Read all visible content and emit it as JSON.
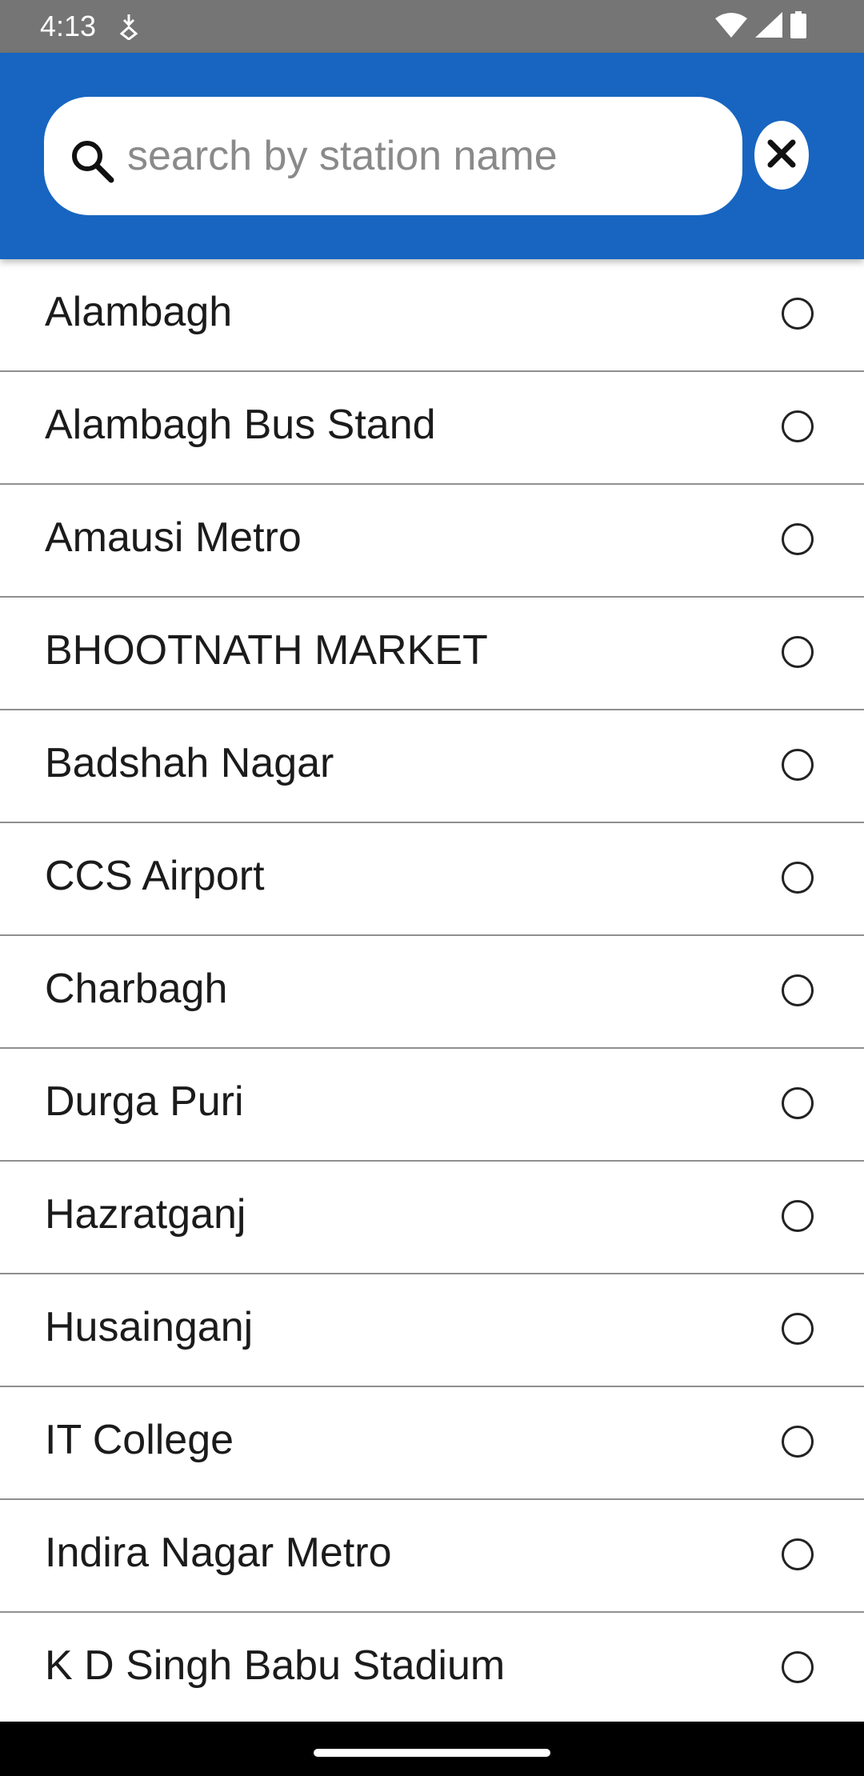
{
  "status_bar": {
    "time": "4:13",
    "left_icon": "accessibility-download-icon",
    "right_icons": [
      "wifi-icon",
      "cellular-signal-icon",
      "battery-icon"
    ]
  },
  "search": {
    "placeholder": "search by station name",
    "value": "",
    "search_icon": "search-icon",
    "clear_icon": "close-icon"
  },
  "colors": {
    "app_bar": "#1765c1",
    "status_bar": "#757575",
    "nav_bar": "#000000",
    "divider": "#8f8f8f"
  },
  "stations": [
    {
      "name": "Alambagh",
      "selected": false
    },
    {
      "name": "Alambagh Bus Stand",
      "selected": false
    },
    {
      "name": "Amausi Metro",
      "selected": false
    },
    {
      "name": "BHOOTNATH MARKET",
      "selected": false
    },
    {
      "name": "Badshah Nagar",
      "selected": false
    },
    {
      "name": "CCS Airport",
      "selected": false
    },
    {
      "name": "Charbagh",
      "selected": false
    },
    {
      "name": "Durga Puri",
      "selected": false
    },
    {
      "name": "Hazratganj",
      "selected": false
    },
    {
      "name": "Husainganj",
      "selected": false
    },
    {
      "name": "IT College",
      "selected": false
    },
    {
      "name": "Indira Nagar Metro",
      "selected": false
    },
    {
      "name": "K D Singh Babu Stadium",
      "selected": false
    }
  ]
}
